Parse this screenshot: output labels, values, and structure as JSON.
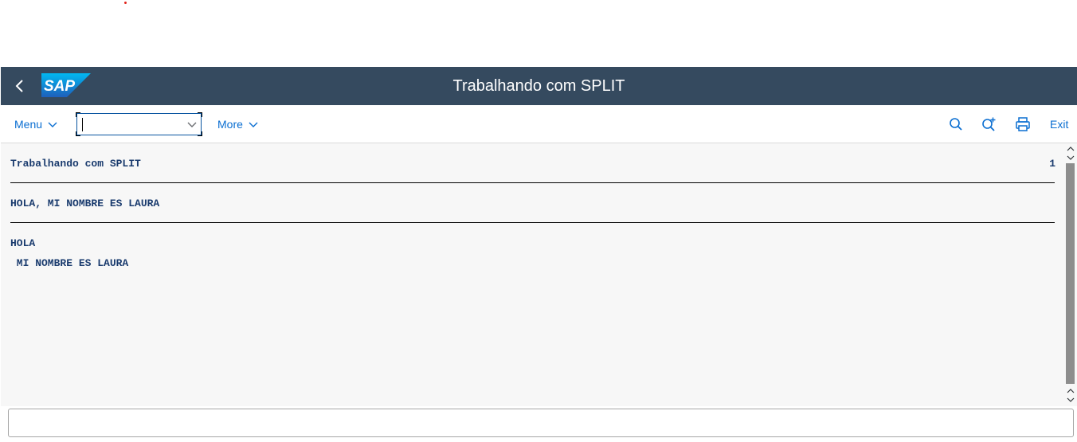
{
  "shell": {
    "title": "Trabalhando com SPLIT",
    "logo_text": "SAP",
    "colors": {
      "shell_bg": "#354a5f",
      "logo_blue": "#1a9ad7",
      "link_blue": "#0a6ed1"
    }
  },
  "toolbar": {
    "menu_label": "Menu",
    "command_field": {
      "value": "",
      "placeholder": ""
    },
    "more_label": "More",
    "icons": [
      "search-icon",
      "search-plus-icon",
      "print-icon"
    ],
    "exit_label": "Exit"
  },
  "report": {
    "heading": "Trabalhando com SPLIT",
    "page_number": "1",
    "lines": [
      "HOLA, MI NOMBRE ES LAURA",
      "HOLA",
      " MI NOMBRE ES LAURA"
    ]
  }
}
